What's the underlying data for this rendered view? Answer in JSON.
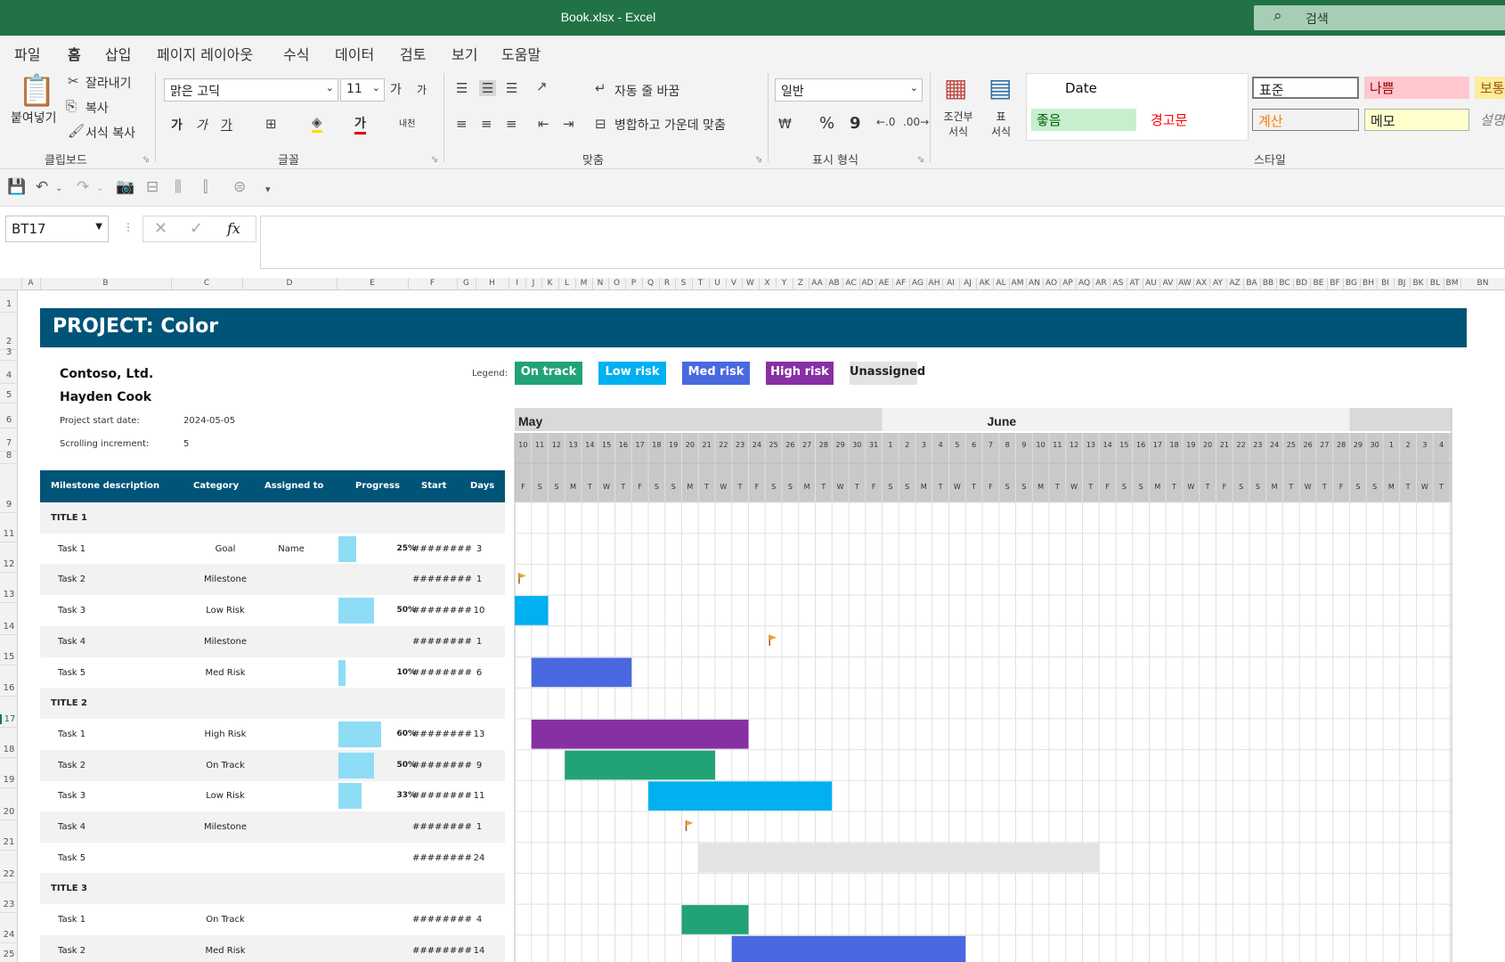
{
  "window": {
    "title": "Book.xlsx  -  Excel",
    "search_placeholder": "검색"
  },
  "menu": {
    "tabs": [
      "파일",
      "홈",
      "삽입",
      "페이지 레이아웃",
      "수식",
      "데이터",
      "검토",
      "보기",
      "도움말"
    ],
    "active": "홈"
  },
  "ribbon": {
    "clipboard": {
      "paste": "붙여넣기",
      "cut": "잘라내기",
      "copy": "복사",
      "format_painter": "서식 복사",
      "label": "클립보드"
    },
    "font": {
      "name": "맑은 고딕",
      "size": "11",
      "grow": "가",
      "shrink": "가",
      "bold": "가",
      "italic": "가",
      "underline": "가",
      "color_char": "가",
      "phonetic": "내천",
      "label": "글꼴"
    },
    "alignment": {
      "wrap": "자동 줄 바꿈",
      "merge": "병합하고 가운데 맞춤",
      "label": "맞춤"
    },
    "number": {
      "format": "일반",
      "percent": "%",
      "comma": "9",
      "label": "표시 형식"
    },
    "styles": {
      "conditional": "조건부 서식",
      "conditional_line1": "조건부",
      "conditional_line2": "서식",
      "table": "표 서식",
      "table_line1": "표",
      "table_line2": "서식",
      "cells": [
        "Date",
        "표준",
        "나쁨",
        "보통",
        "좋음",
        "경고문",
        "계산",
        "메모",
        "설명"
      ],
      "label": "스타일"
    }
  },
  "formula_bar": {
    "name_box": "BT17",
    "fx": "fx",
    "value": ""
  },
  "columns": [
    "A",
    "B",
    "C",
    "D",
    "E",
    "F",
    "G",
    "H",
    "I",
    "J",
    "K",
    "L",
    "M",
    "N",
    "O",
    "P",
    "Q",
    "R",
    "S",
    "T",
    "U",
    "V",
    "W",
    "X",
    "Y",
    "Z",
    "AA",
    "AB",
    "AC",
    "AD",
    "AE",
    "AF",
    "AG",
    "AH",
    "AI",
    "AJ",
    "AK",
    "AL",
    "AM",
    "AN",
    "AO",
    "AP",
    "AQ",
    "AR",
    "AS",
    "AT",
    "AU",
    "AV",
    "AW",
    "AX",
    "AY",
    "AZ",
    "BA",
    "BB",
    "BC",
    "BD",
    "BE",
    "BF",
    "BG",
    "BH",
    "BI",
    "BJ",
    "BK",
    "BL",
    "BM",
    "BN"
  ],
  "rows": [
    "1",
    "2",
    "3",
    "4",
    "5",
    "6",
    "7",
    "8",
    "9",
    "11",
    "12",
    "13",
    "14",
    "15",
    "16",
    "17",
    "18",
    "19",
    "20",
    "21",
    "22",
    "23",
    "24",
    "25"
  ],
  "selected_row": "17",
  "sheet": {
    "project_title": "PROJECT: Color",
    "company": "Contoso, Ltd.",
    "manager": "Hayden Cook",
    "start_label": "Project start date:",
    "start_value": "2024-05-05",
    "scroll_label": "Scrolling increment:",
    "scroll_value": "5",
    "legend_label": "Legend:",
    "legend": [
      {
        "label": "On track",
        "color": "#21a375"
      },
      {
        "label": "Low risk",
        "color": "#00b0f0"
      },
      {
        "label": "Med risk",
        "color": "#4a68e0"
      },
      {
        "label": "High risk",
        "color": "#8730a3"
      },
      {
        "label": "Unassigned",
        "color": "#e3e3e3"
      }
    ],
    "table_headers": [
      "Milestone description",
      "Category",
      "Assigned to",
      "Progress",
      "Start",
      "Days"
    ],
    "tasks": [
      {
        "desc": "TITLE 1",
        "title": true
      },
      {
        "desc": "Task 1",
        "category": "Goal",
        "assigned": "Name",
        "progress": 25,
        "progress_label": "25%",
        "start": "########",
        "days": "3"
      },
      {
        "desc": "Task 2",
        "category": "Milestone",
        "assigned": "",
        "progress": null,
        "progress_label": "",
        "start": "########",
        "days": "1"
      },
      {
        "desc": "Task 3",
        "category": "Low Risk",
        "assigned": "",
        "progress": 50,
        "progress_label": "50%",
        "start": "########",
        "days": "10"
      },
      {
        "desc": "Task 4",
        "category": "Milestone",
        "assigned": "",
        "progress": null,
        "progress_label": "",
        "start": "########",
        "days": "1"
      },
      {
        "desc": "Task 5",
        "category": "Med Risk",
        "assigned": "",
        "progress": 10,
        "progress_label": "10%",
        "start": "########",
        "days": "6"
      },
      {
        "desc": "TITLE 2",
        "title": true
      },
      {
        "desc": "Task 1",
        "category": "High Risk",
        "assigned": "",
        "progress": 60,
        "progress_label": "60%",
        "start": "########",
        "days": "13"
      },
      {
        "desc": "Task 2",
        "category": "On Track",
        "assigned": "",
        "progress": 50,
        "progress_label": "50%",
        "start": "########",
        "days": "9"
      },
      {
        "desc": "Task 3",
        "category": "Low Risk",
        "assigned": "",
        "progress": 33,
        "progress_label": "33%",
        "start": "########",
        "days": "11"
      },
      {
        "desc": "Task 4",
        "category": "Milestone",
        "assigned": "",
        "progress": null,
        "progress_label": "",
        "start": "########",
        "days": "1"
      },
      {
        "desc": "Task 5",
        "category": "",
        "assigned": "",
        "progress": null,
        "progress_label": "",
        "start": "########",
        "days": "24"
      },
      {
        "desc": "TITLE 3",
        "title": true
      },
      {
        "desc": "Task 1",
        "category": "On Track",
        "assigned": "",
        "progress": null,
        "progress_label": "",
        "start": "########",
        "days": "4"
      },
      {
        "desc": "Task 2",
        "category": "Med Risk",
        "assigned": "",
        "progress": null,
        "progress_label": "",
        "start": "########",
        "days": "14"
      }
    ]
  },
  "chart_data": {
    "type": "gantt",
    "months": [
      {
        "label": "May",
        "start_index": 0
      },
      {
        "label": "June",
        "start_index": 22
      }
    ],
    "days": [
      "10",
      "11",
      "12",
      "13",
      "14",
      "15",
      "16",
      "17",
      "18",
      "19",
      "20",
      "21",
      "22",
      "23",
      "24",
      "25",
      "26",
      "27",
      "28",
      "29",
      "30",
      "31",
      "1",
      "2",
      "3",
      "4",
      "5",
      "6",
      "7",
      "8",
      "9",
      "10",
      "11",
      "12",
      "13",
      "14",
      "15",
      "16",
      "17",
      "18",
      "19",
      "20",
      "21",
      "22",
      "23",
      "24",
      "25",
      "26",
      "27",
      "28",
      "29",
      "30",
      "1",
      "2",
      "3",
      "4"
    ],
    "weekdays": [
      "F",
      "S",
      "S",
      "M",
      "T",
      "W",
      "T",
      "F",
      "S",
      "S",
      "M",
      "T",
      "W",
      "T",
      "F",
      "S",
      "S",
      "M",
      "T",
      "W",
      "T",
      "F",
      "S",
      "S",
      "M",
      "T",
      "W",
      "T",
      "F",
      "S",
      "S",
      "M",
      "T",
      "W",
      "T",
      "F",
      "S",
      "S",
      "M",
      "T",
      "W",
      "T",
      "F",
      "S",
      "S",
      "M",
      "T",
      "W",
      "T",
      "F",
      "S",
      "S",
      "M",
      "T",
      "W",
      "T"
    ],
    "bars": [
      {
        "row": 2,
        "type": "milestone",
        "start": 0,
        "days": 1
      },
      {
        "row": 3,
        "type": "bar",
        "start": 0,
        "days": 2,
        "color": "#00b0f0"
      },
      {
        "row": 4,
        "type": "milestone",
        "start": 15,
        "days": 1
      },
      {
        "row": 5,
        "type": "bar",
        "start": 1,
        "days": 6,
        "color": "#4a68e0"
      },
      {
        "row": 7,
        "type": "bar",
        "start": 1,
        "days": 13,
        "color": "#8730a3"
      },
      {
        "row": 8,
        "type": "bar",
        "start": 3,
        "days": 9,
        "color": "#21a375"
      },
      {
        "row": 9,
        "type": "bar",
        "start": 8,
        "days": 11,
        "color": "#00b0f0"
      },
      {
        "row": 10,
        "type": "milestone",
        "start": 10,
        "days": 1
      },
      {
        "row": 11,
        "type": "bar",
        "start": 11,
        "days": 24,
        "color": "#e3e3e3"
      },
      {
        "row": 13,
        "type": "bar",
        "start": 10,
        "days": 4,
        "color": "#21a375"
      },
      {
        "row": 14,
        "type": "bar",
        "start": 13,
        "days": 14,
        "color": "#4a68e0"
      }
    ]
  }
}
